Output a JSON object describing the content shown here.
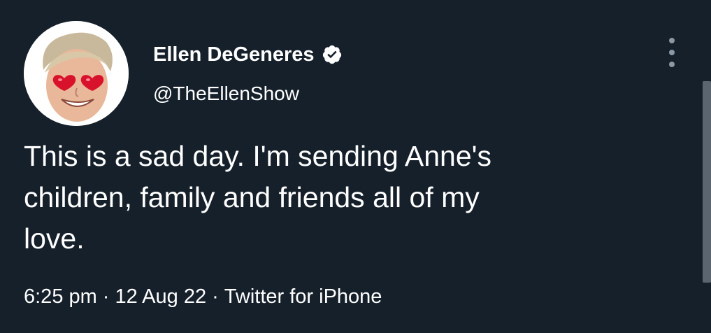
{
  "tweet": {
    "display_name": "Ellen DeGeneres",
    "handle": "@TheEllenShow",
    "text": "This is a sad day. I'm sending Anne's\nchildren, family and friends all of my\nlove.",
    "time": "6:25 pm",
    "date": "12 Aug 22",
    "source": "Twitter for iPhone",
    "separator": "·"
  },
  "icons": {
    "verified": "verified-badge-icon",
    "more": "more-options-icon",
    "avatar": "avatar-heart-eyes"
  },
  "colors": {
    "background": "#15202b",
    "text": "#ffffff",
    "verified": "#ffffff",
    "more": "#8b98a5"
  }
}
